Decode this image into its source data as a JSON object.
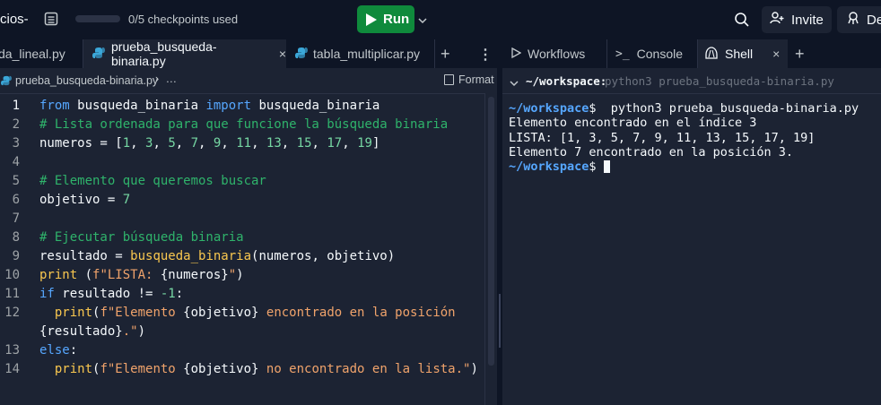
{
  "topbar": {
    "project_name": "cios-",
    "checkpoints": "0/5 checkpoints used",
    "run_label": "Run",
    "invite_label": "Invite",
    "deploy_label": "De"
  },
  "editor": {
    "tabs": [
      {
        "label": "da_lineal.py"
      },
      {
        "label": "prueba_busqueda-binaria.py"
      },
      {
        "label": "tabla_multiplicar.py"
      }
    ],
    "path": "prueba_busqueda-binaria.py",
    "path_more": "…",
    "format_label": "Format",
    "lines": [
      {
        "n": "1",
        "segs": [
          {
            "t": "from",
            "c": "kw"
          },
          {
            "t": " busqueda_binaria ",
            "c": ""
          },
          {
            "t": "import",
            "c": "kw"
          },
          {
            "t": " busqueda_binaria",
            "c": ""
          }
        ]
      },
      {
        "n": "2",
        "segs": [
          {
            "t": "# Lista ordenada para que funcione la búsqueda binaria",
            "c": "com"
          }
        ]
      },
      {
        "n": "3",
        "segs": [
          {
            "t": "numeros = [",
            "c": ""
          },
          {
            "t": "1",
            "c": "num"
          },
          {
            "t": ", ",
            "c": ""
          },
          {
            "t": "3",
            "c": "num"
          },
          {
            "t": ", ",
            "c": ""
          },
          {
            "t": "5",
            "c": "num"
          },
          {
            "t": ", ",
            "c": ""
          },
          {
            "t": "7",
            "c": "num"
          },
          {
            "t": ", ",
            "c": ""
          },
          {
            "t": "9",
            "c": "num"
          },
          {
            "t": ", ",
            "c": ""
          },
          {
            "t": "11",
            "c": "num"
          },
          {
            "t": ", ",
            "c": ""
          },
          {
            "t": "13",
            "c": "num"
          },
          {
            "t": ", ",
            "c": ""
          },
          {
            "t": "15",
            "c": "num"
          },
          {
            "t": ", ",
            "c": ""
          },
          {
            "t": "17",
            "c": "num"
          },
          {
            "t": ", ",
            "c": ""
          },
          {
            "t": "19",
            "c": "num"
          },
          {
            "t": "]",
            "c": ""
          }
        ]
      },
      {
        "n": "4",
        "segs": []
      },
      {
        "n": "5",
        "segs": [
          {
            "t": "# Elemento que queremos buscar",
            "c": "com"
          }
        ]
      },
      {
        "n": "6",
        "segs": [
          {
            "t": "objetivo = ",
            "c": ""
          },
          {
            "t": "7",
            "c": "num"
          }
        ]
      },
      {
        "n": "7",
        "segs": []
      },
      {
        "n": "8",
        "segs": [
          {
            "t": "# Ejecutar búsqueda binaria",
            "c": "com"
          }
        ]
      },
      {
        "n": "9",
        "segs": [
          {
            "t": "resultado = ",
            "c": ""
          },
          {
            "t": "busqueda_binaria",
            "c": "fn"
          },
          {
            "t": "(numeros, objetivo)",
            "c": ""
          }
        ]
      },
      {
        "n": "10",
        "segs": [
          {
            "t": "print",
            "c": "fn"
          },
          {
            "t": " (",
            "c": ""
          },
          {
            "t": "f\"LISTA: ",
            "c": "str"
          },
          {
            "t": "{numeros}",
            "c": ""
          },
          {
            "t": "\"",
            "c": "str"
          },
          {
            "t": ")",
            "c": ""
          }
        ]
      },
      {
        "n": "11",
        "segs": [
          {
            "t": "if",
            "c": "kw"
          },
          {
            "t": " resultado != ",
            "c": ""
          },
          {
            "t": "-1",
            "c": "num"
          },
          {
            "t": ":",
            "c": ""
          }
        ]
      },
      {
        "n": "12",
        "segs": [
          {
            "t": "  ",
            "c": ""
          },
          {
            "t": "print",
            "c": "fn"
          },
          {
            "t": "(",
            "c": ""
          },
          {
            "t": "f\"Elemento ",
            "c": "str"
          },
          {
            "t": "{objetivo}",
            "c": ""
          },
          {
            "t": " encontrado en la posición",
            "c": "str"
          }
        ]
      },
      {
        "n": "",
        "segs": [
          {
            "t": "{resultado}",
            "c": ""
          },
          {
            "t": ".\"",
            "c": "str"
          },
          {
            "t": ")",
            "c": ""
          }
        ]
      },
      {
        "n": "13",
        "segs": [
          {
            "t": "else",
            "c": "kw"
          },
          {
            "t": ":",
            "c": ""
          }
        ]
      },
      {
        "n": "14",
        "segs": [
          {
            "t": "  ",
            "c": ""
          },
          {
            "t": "print",
            "c": "fn"
          },
          {
            "t": "(",
            "c": ""
          },
          {
            "t": "f\"Elemento ",
            "c": "str"
          },
          {
            "t": "{objetivo}",
            "c": ""
          },
          {
            "t": " no encontrado en la lista.\"",
            "c": "str"
          },
          {
            "t": ")",
            "c": ""
          }
        ]
      }
    ]
  },
  "right": {
    "tabs": [
      {
        "label": "Workflows"
      },
      {
        "label": "Console"
      },
      {
        "label": "Shell"
      }
    ],
    "shell_prompt_path": "~/workspace:",
    "shell_header_cmd": "python3 prueba_busqueda-binaria.py",
    "shell_lines": [
      {
        "prompt": "~/workspace",
        "text": "$  python3 prueba_busqueda-binaria.py"
      },
      {
        "prompt": "",
        "text": "Elemento encontrado en el índice 3"
      },
      {
        "prompt": "",
        "text": "LISTA: [1, 3, 5, 7, 9, 11, 13, 15, 17, 19]"
      },
      {
        "prompt": "",
        "text": "Elemento 7 encontrado en la posición 3."
      },
      {
        "prompt": "~/workspace",
        "text": "$ "
      }
    ]
  },
  "colors": {
    "accent_run": "#0f8a3c",
    "prompt_blue": "#56a7ff",
    "background": "#1c2333",
    "chrome": "#0e1525"
  }
}
